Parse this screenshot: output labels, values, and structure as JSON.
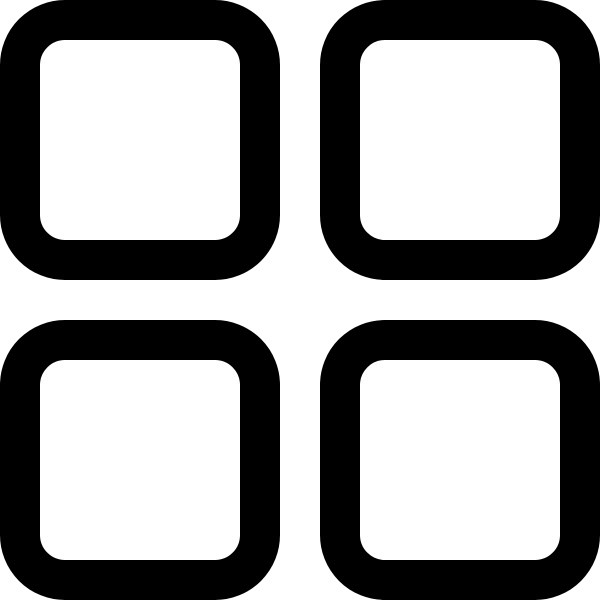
{
  "icon": {
    "name": "grid-view-icon",
    "description_name": "four-squares-grid",
    "stroke_color": "#000000",
    "background_color": "#ffffff",
    "tiles": [
      {
        "id": "top-left"
      },
      {
        "id": "top-right"
      },
      {
        "id": "bottom-left"
      },
      {
        "id": "bottom-right"
      }
    ]
  }
}
